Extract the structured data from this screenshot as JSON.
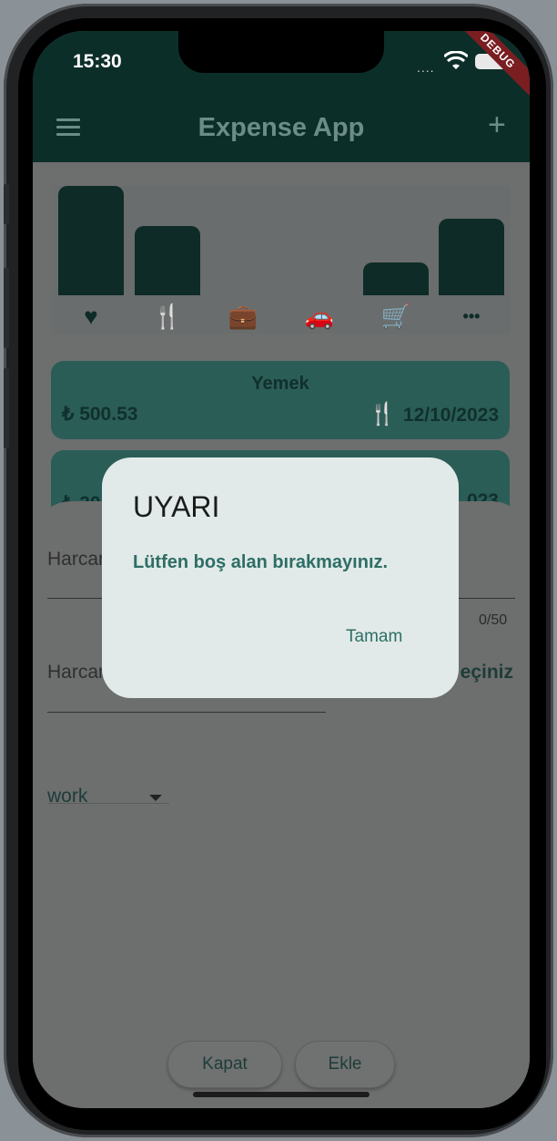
{
  "status_bar": {
    "time": "15:30",
    "signal": "....",
    "debug_banner": "DEBUG"
  },
  "app_bar": {
    "title": "Expense App"
  },
  "chart_data": {
    "type": "bar",
    "categories": [
      "heart",
      "restaurant",
      "work",
      "car",
      "cart",
      "more"
    ],
    "values": [
      100,
      63,
      0,
      0,
      30,
      70
    ],
    "ylim": [
      0,
      100
    ],
    "grid": false,
    "bar_color": "#0e2b27"
  },
  "chart_icons": [
    "heart-icon",
    "restaurant-icon",
    "briefcase-icon",
    "car-icon",
    "cart-icon",
    "more-icon"
  ],
  "expenses": [
    {
      "title": "Yemek",
      "amount": "₺ 500.53",
      "date": "12/10/2023",
      "icon": "restaurant-icon"
    },
    {
      "title": "",
      "amount": "₺ 30",
      "date": "023",
      "icon": ""
    }
  ],
  "form": {
    "name_label": "Harcama",
    "name_counter": "0/50",
    "amount_label": "Harcama",
    "date_button": "eçiniz",
    "category_value": "work",
    "close_button": "Kapat",
    "add_button": "Ekle"
  },
  "dialog": {
    "title": "UYARI",
    "message": "Lütfen boş alan bırakmayınız.",
    "ok_button": "Tamam"
  },
  "colors": {
    "primary": "#0c2e29",
    "accent": "#2e6e66",
    "dialog_bg": "#e1eae8",
    "card_bg": "#2b5d57"
  }
}
